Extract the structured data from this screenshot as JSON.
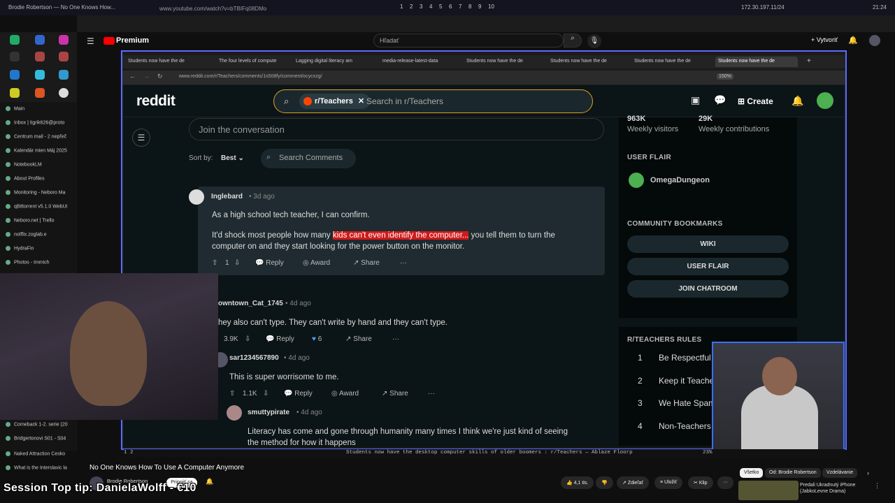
{
  "os": {
    "window_title": "Brodie Robertson — No One Knows How...",
    "workspaces": [
      "1",
      "2",
      "3",
      "4",
      "5",
      "6",
      "7",
      "8",
      "9",
      "10"
    ],
    "ip": "172.30.197.11/24",
    "clock": "21:24"
  },
  "youtube": {
    "url": "www.youtube.com/watch?v=bTBIFq08DMo",
    "logo": "Premium",
    "search_placeholder": "Hľadať",
    "create": "Vytvoriť",
    "video_title": "No One Knows How To Use A Computer Anymore",
    "channel": "Brodie Robertson",
    "join": "Pripojiť sa",
    "likes": "4,1 tis.",
    "share": "Zdieľať",
    "save": "Uložiť",
    "clip": "Klip",
    "tabs": [
      "Všetko",
      "Od: Brodie Robertson",
      "Vzdelávanie"
    ],
    "rec_title": "Predali Ukradnutý iPhone (JabkoLevne Drama)"
  },
  "left_sidebar": [
    "Main",
    "Inbox | tigrik626@proto",
    "Centrum mail - 2 nepřeč",
    "Kalendár mien Máj 2025",
    "NotebookLM",
    "About Profiles",
    "Monitoring - Neboro Ma",
    "qBittorrent v5.1.0 WebUI",
    "Neboro.net | Trello",
    "notflix.zoglab.e",
    "HydraFin",
    "Photos - Immich"
  ],
  "left_sidebar_bottom": [
    "Comeback 1-2. serie (20",
    "Bridgertonovi S01 - S04",
    "Naked Attraction Česko",
    "What is the Interslavic la"
  ],
  "browser": {
    "tabs": [
      "Students now have the de",
      "The four levels of compute",
      "Lagging digital literacy am",
      "media-release-latest-data",
      "Students now have the de",
      "Students now have the de",
      "Students now have the de",
      "Students now have the de"
    ],
    "address": "www.reddit.com/r/Teachers/comments/1s508fy/comment/ocycxzg/",
    "zoom": "150%"
  },
  "reddit": {
    "logo": "reddit",
    "subreddit_chip": "r/Teachers",
    "search_placeholder": "Search in r/Teachers",
    "create": "Create",
    "join_placeholder": "Join the conversation",
    "sort_label": "Sort by:",
    "sort_value": "Best",
    "search_comments": "Search Comments",
    "comments": [
      {
        "author": "Inglebard",
        "time": "3d ago",
        "line1": "As a high school tech teacher, I can confirm.",
        "line2_pre": "It'd shock most people how many ",
        "line2_hl": "kids can't even identify the computer...",
        "line2_post": " you tell them to turn the",
        "line3": "computer on and they start looking for the power button on the monitor.",
        "votes": "1",
        "reply": "Reply",
        "award": "Award",
        "share": "Share"
      },
      {
        "author": "owntown_Cat_1745",
        "time": "4d ago",
        "text": "hey also can't type. They can't write by hand and they can't type.",
        "votes": "3.9K",
        "reply": "Reply",
        "awards": "6",
        "share": "Share"
      },
      {
        "author": "sar1234567890",
        "time": "4d ago",
        "text": "This is super worrisome to me.",
        "votes": "1.1K",
        "reply": "Reply",
        "award": "Award",
        "share": "Share"
      },
      {
        "author": "smuttypirate",
        "time": "4d ago",
        "line1": "Literacy has come and gone through humanity many times I think we're just kind of seeing",
        "line2": "the method for how it happens"
      }
    ],
    "sidebar": {
      "visitors_value": "963K",
      "visitors_label": "Weekly visitors",
      "contrib_value": "29K",
      "contrib_label": "Weekly contributions",
      "user_flair_heading": "USER FLAIR",
      "user_flair_name": "OmegaDungeon",
      "bookmarks_heading": "COMMUNITY BOOKMARKS",
      "bookmarks": [
        "WIKI",
        "USER FLAIR",
        "JOIN CHATROOM"
      ],
      "rules_heading": "R/TEACHERS RULES",
      "rules": [
        {
          "n": "1",
          "t": "Be Respectful"
        },
        {
          "n": "2",
          "t": "Keep it Teacher"
        },
        {
          "n": "3",
          "t": "We Hate Spam"
        },
        {
          "n": "4",
          "t": "Non-Teachers P"
        }
      ]
    }
  },
  "status_bar": {
    "left": "1 2",
    "center": "Students now have the desktop computer skills of older boomers : r/Teachers — Ablaze Floorp",
    "right": "23%"
  },
  "overlay_text": "Session Top tip: DanielaWolff - €10",
  "colors": {
    "accent_blue": "#5a6cff",
    "reddit_orange": "#ff4500",
    "highlight_red": "#d11a1a"
  }
}
